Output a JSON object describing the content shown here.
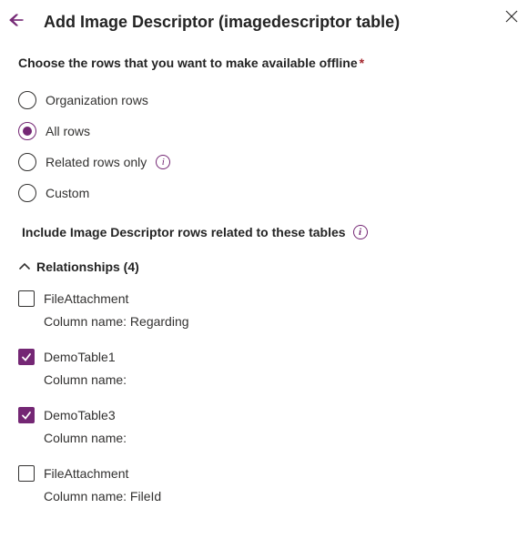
{
  "header": {
    "title": "Add Image Descriptor (imagedescriptor table)"
  },
  "choose": {
    "label": "Choose the rows that you want to make available offline",
    "required_mark": "*",
    "options": [
      {
        "label": "Organization rows",
        "selected": false,
        "has_info": false
      },
      {
        "label": "All rows",
        "selected": true,
        "has_info": false
      },
      {
        "label": "Related rows only",
        "selected": false,
        "has_info": true
      },
      {
        "label": "Custom",
        "selected": false,
        "has_info": false
      }
    ]
  },
  "include": {
    "label": "Include Image Descriptor rows related to these tables"
  },
  "relationships": {
    "header": "Relationships (4)",
    "column_prefix": "Column name:",
    "items": [
      {
        "name": "FileAttachment",
        "column": "Regarding",
        "checked": false
      },
      {
        "name": "DemoTable1",
        "column": "",
        "checked": true
      },
      {
        "name": "DemoTable3",
        "column": "",
        "checked": true
      },
      {
        "name": "FileAttachment",
        "column": "FileId",
        "checked": false
      }
    ]
  }
}
